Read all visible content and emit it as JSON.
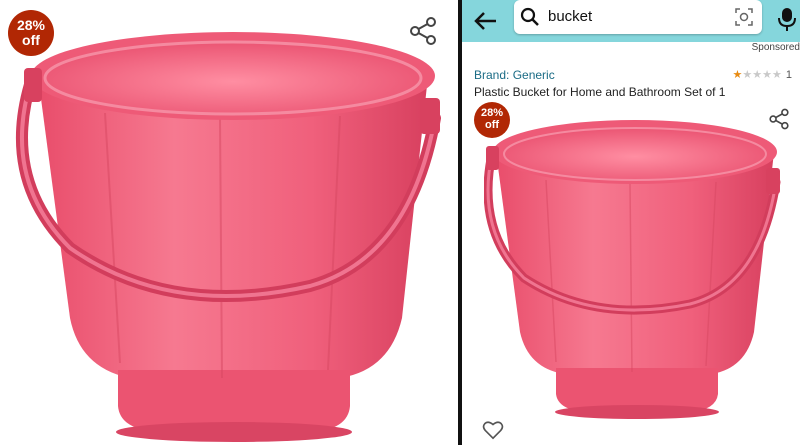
{
  "left_panel": {
    "discount_badge": {
      "percent": "28%",
      "off": "off"
    }
  },
  "right_panel": {
    "search": {
      "query": "bucket"
    },
    "sponsored_label": "Sponsored",
    "product": {
      "brand": "Brand: Generic",
      "title": "Plastic Bucket for Home and Bathroom Set of 1",
      "rating": {
        "stars": 1,
        "max": 5,
        "count": "1"
      },
      "discount_badge": {
        "percent": "28%",
        "off": "off"
      }
    }
  },
  "colors": {
    "badge": "#b12704",
    "header": "#85d6dc",
    "bucket": "#f2637f",
    "link": "#1a6b85",
    "star": "#e88b12"
  },
  "icons": [
    "share-icon",
    "back-arrow-icon",
    "search-icon",
    "camera-icon",
    "mic-icon",
    "heart-icon"
  ]
}
